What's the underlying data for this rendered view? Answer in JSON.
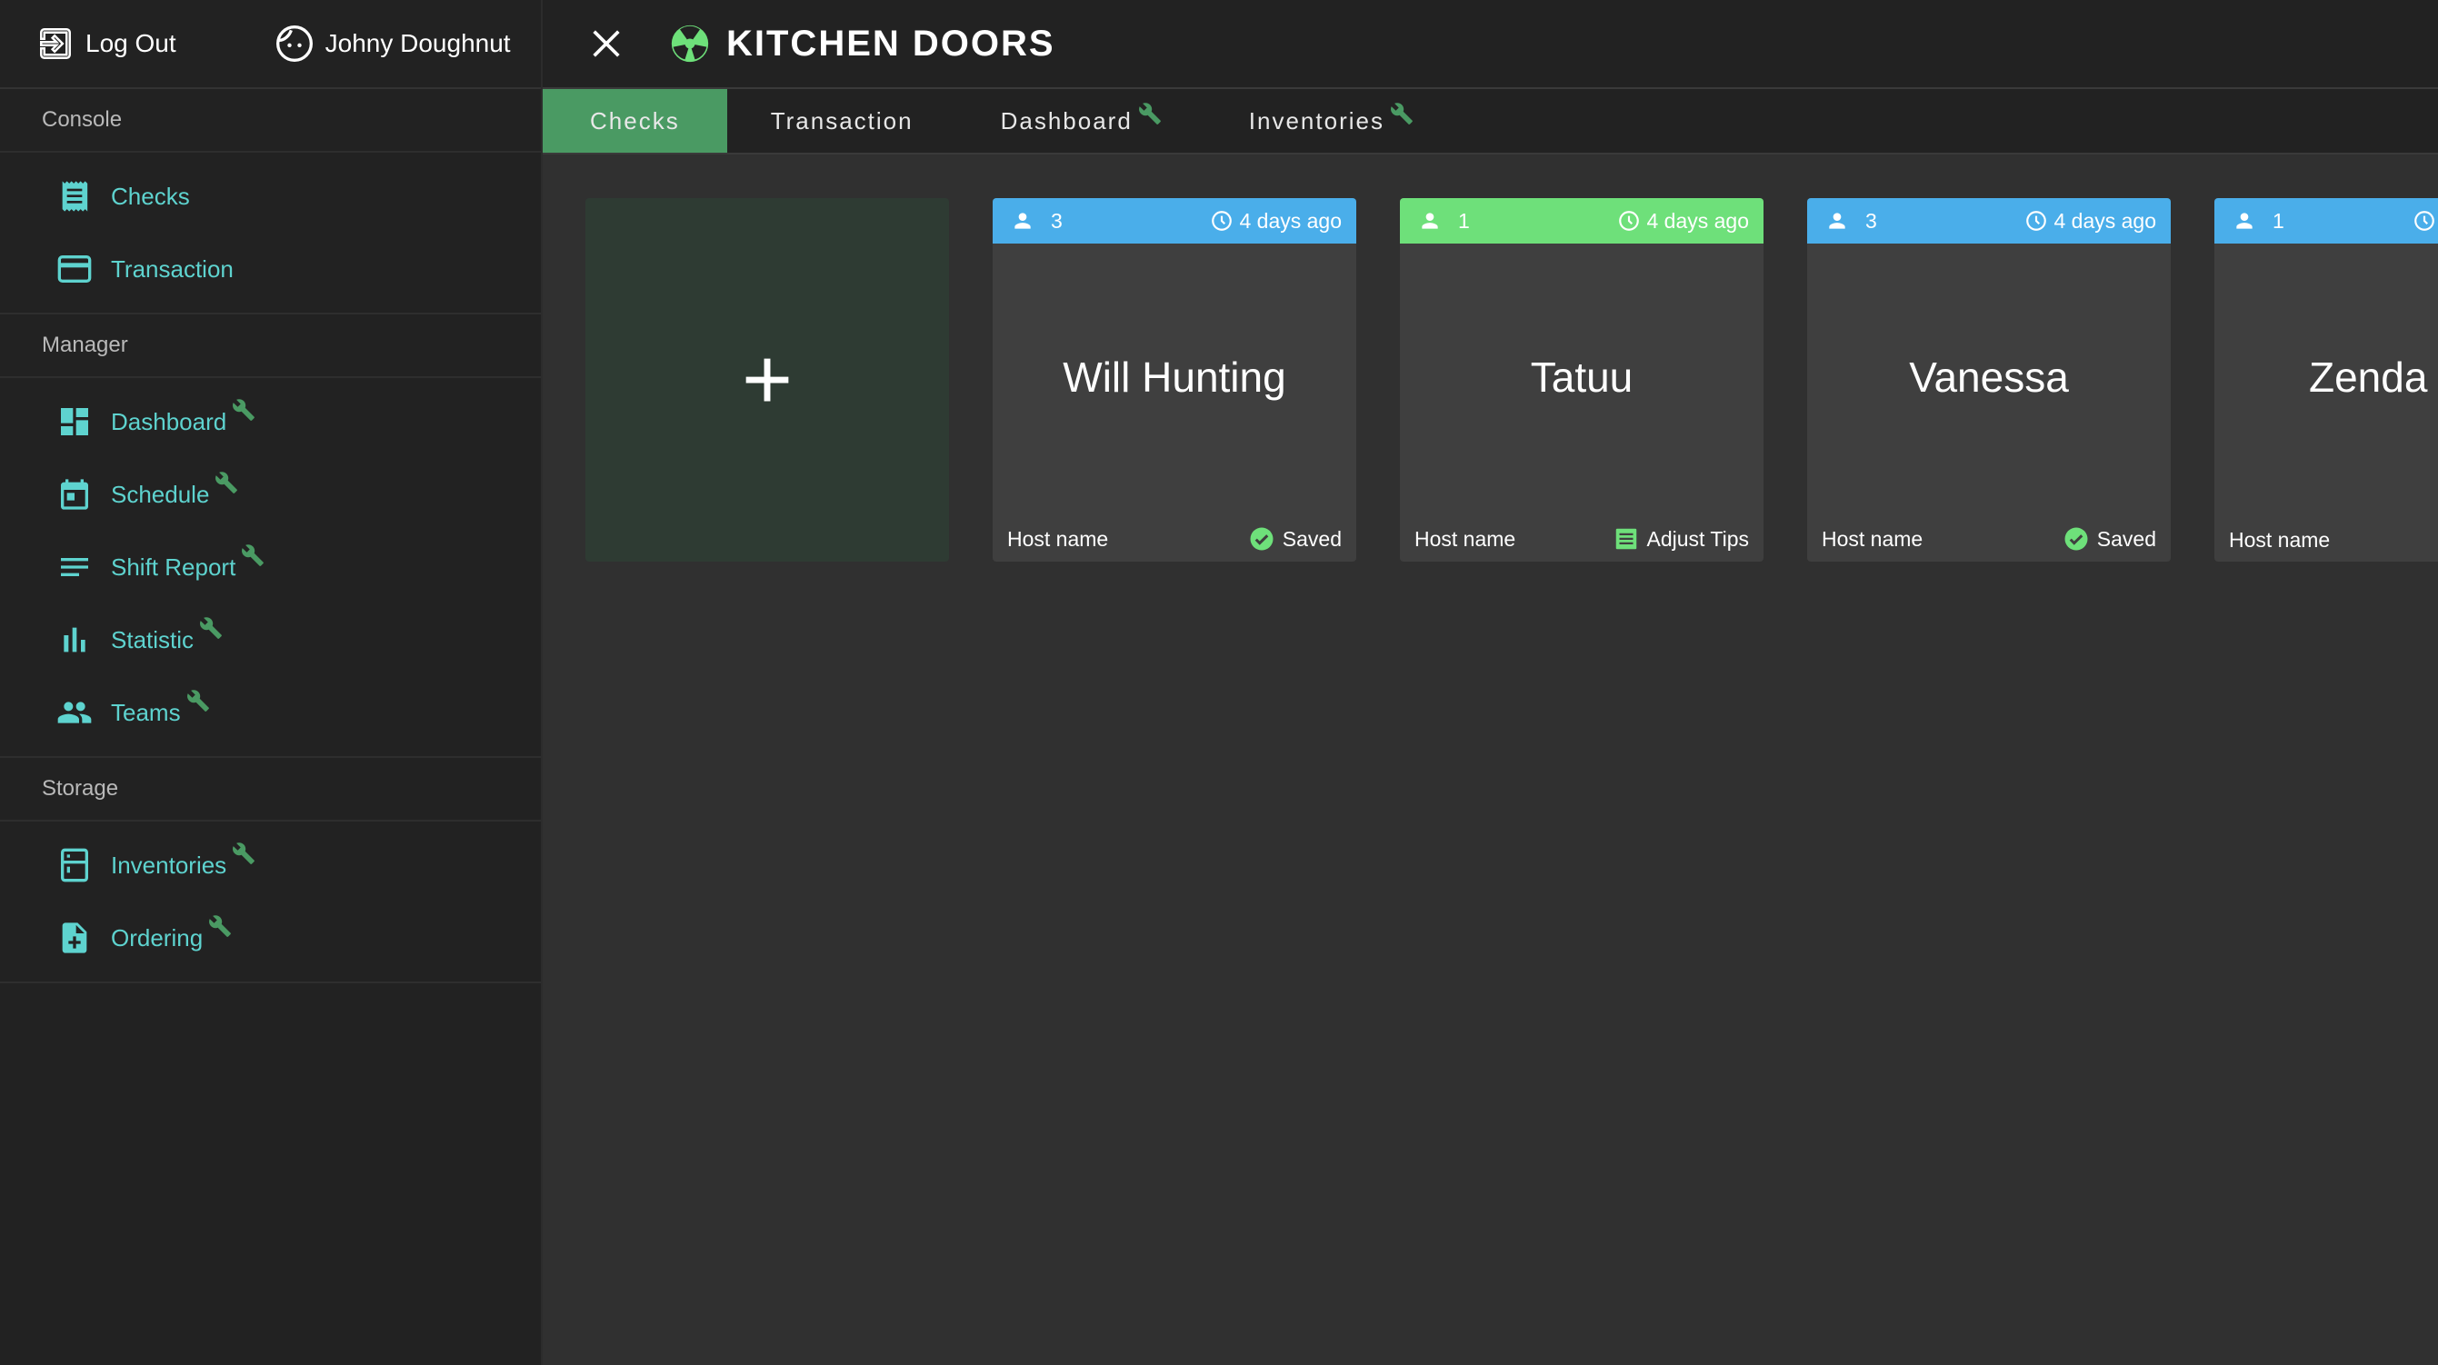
{
  "header": {
    "logout_label": "Log Out",
    "user_name": "Johny Doughnut"
  },
  "sidebar": {
    "sections": [
      {
        "title": "Console",
        "items": [
          {
            "label": "Checks"
          },
          {
            "label": "Transaction"
          }
        ]
      },
      {
        "title": "Manager",
        "items": [
          {
            "label": "Dashboard"
          },
          {
            "label": "Schedule"
          },
          {
            "label": "Shift Report"
          },
          {
            "label": "Statistic"
          },
          {
            "label": "Teams"
          }
        ]
      },
      {
        "title": "Storage",
        "items": [
          {
            "label": "Inventories"
          },
          {
            "label": "Ordering"
          }
        ]
      }
    ]
  },
  "main": {
    "title": "KITCHEN DOORS",
    "tabs": [
      {
        "label": "Checks",
        "active": true
      },
      {
        "label": "Transaction"
      },
      {
        "label": "Dashboard"
      },
      {
        "label": "Inventories"
      }
    ],
    "add_label": "+",
    "cards": [
      {
        "guests": "3",
        "time": "4 days ago",
        "name": "Will Hunting",
        "host": "Host name",
        "status": "Saved",
        "color": "#4aaeea"
      },
      {
        "guests": "1",
        "time": "4 days ago",
        "name": "Tatuu",
        "host": "Host name",
        "status": "Adjust Tips",
        "color": "#6ee07a"
      },
      {
        "guests": "3",
        "time": "4 days ago",
        "name": "Vanessa",
        "host": "Host name",
        "status": "Saved",
        "color": "#4aaeea"
      },
      {
        "guests": "1",
        "time": "",
        "name": "Zenda",
        "host": "Host name",
        "status": "",
        "color": "#4aaeea"
      }
    ]
  },
  "colors": {
    "accent_teal": "#5ed3cf",
    "active_tab": "#4a9a63",
    "brand_green": "#6ee07a",
    "wrench": "#4a9a63"
  }
}
